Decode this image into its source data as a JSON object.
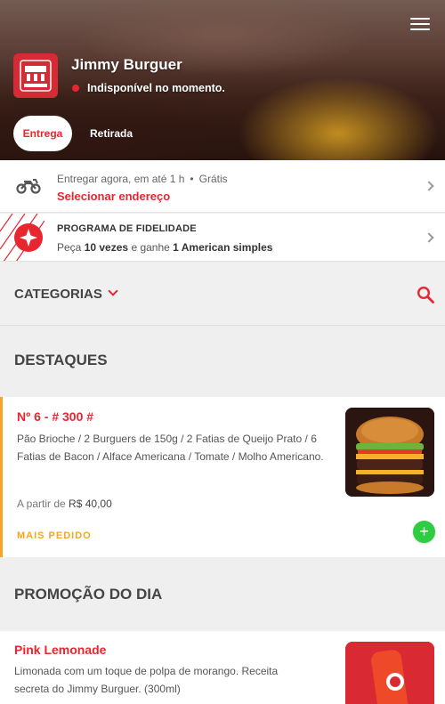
{
  "store": {
    "name": "Jimmy Burguer",
    "status": "Indisponível no momento.",
    "logo_text": "JIMMY BURGUER"
  },
  "tabs": {
    "delivery_label": "Entrega",
    "pickup_label": "Retirada",
    "active": "Entrega"
  },
  "delivery": {
    "time_text": "Entregar agora, em até 1 h",
    "separator": "•",
    "fee_text": "Grátis",
    "address_link": "Selecionar endereço"
  },
  "loyalty": {
    "title": "PROGRAMA DE FIDELIDADE",
    "prefix": "Peça",
    "count": "10 vezes",
    "middle": "e ganhe",
    "reward": "1 American simples"
  },
  "categories": {
    "label": "CATEGORIAS"
  },
  "sections": [
    {
      "title": "DESTAQUES",
      "products": [
        {
          "name": "Nº 6 - # 300 #",
          "description": "Pão Brioche / 2 Burguers de 150g / 2 Fatias de Queijo Prato / 6 Fatias de Bacon / Alface Americana / Tomate / Molho Americano.",
          "price_prefix": "A partir de",
          "price": "R$ 40,00",
          "badge": "MAIS PEDIDO",
          "add_label": "+"
        }
      ]
    },
    {
      "title": "PROMOÇÃO DO DIA",
      "products": [
        {
          "name": "Pink Lemonade",
          "description": "Limonada com um toque de polpa de morango. Receita secreta do Jimmy Burguer. (300ml)"
        }
      ]
    }
  ],
  "colors": {
    "accent": "#e8262f",
    "highlight": "#f5a623",
    "add": "#2ecc40"
  },
  "icons": [
    "menu-icon",
    "motorcycle-icon",
    "star-badge-icon",
    "chevron-right-icon",
    "chevron-down-icon",
    "search-icon",
    "plus-icon"
  ]
}
